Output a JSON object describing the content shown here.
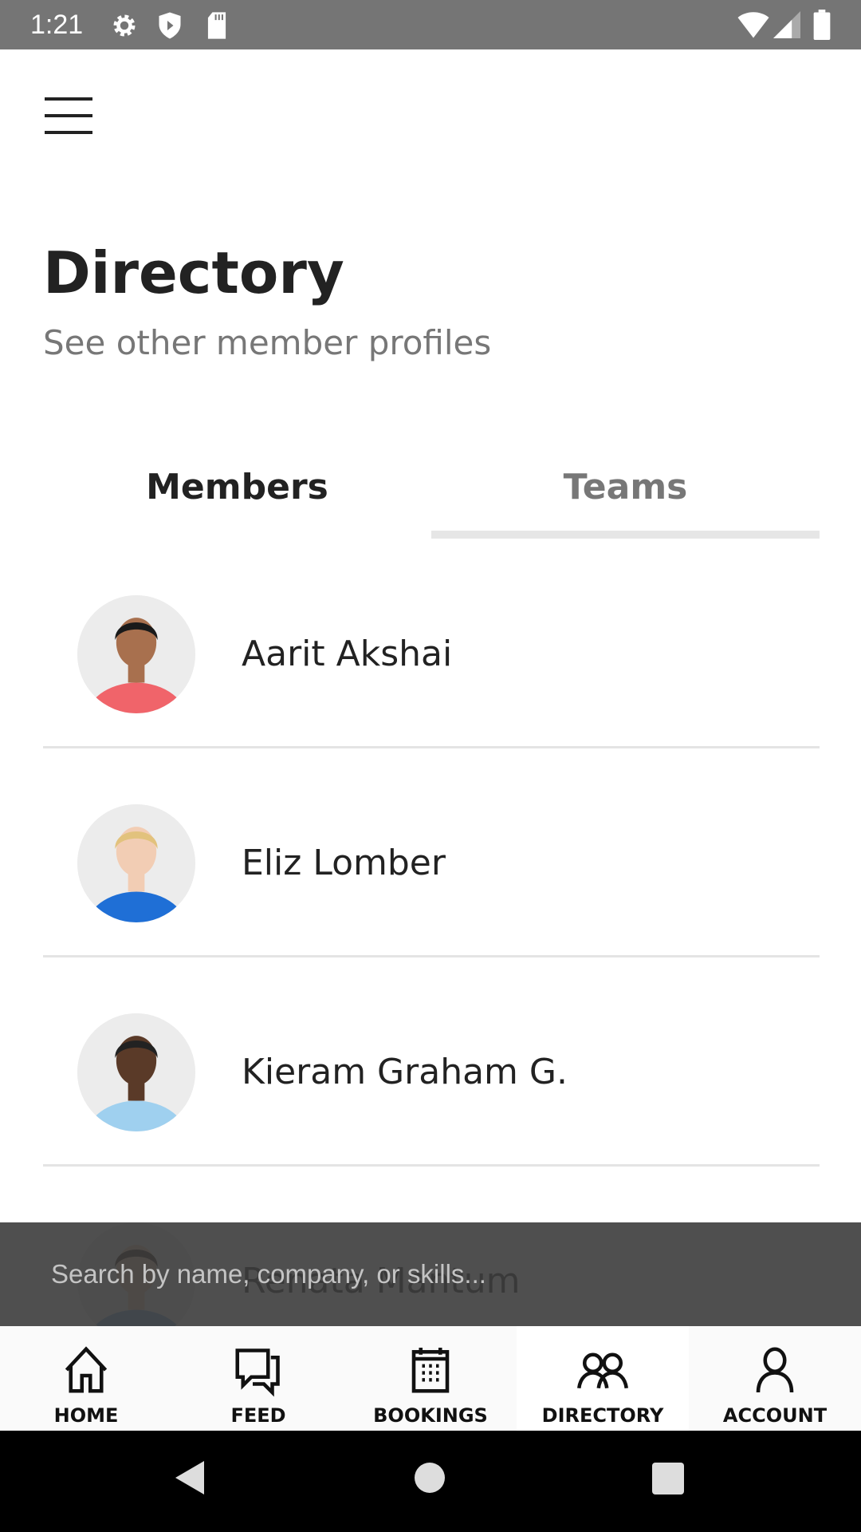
{
  "status_bar": {
    "time": "1:21",
    "icons": [
      "gear-icon",
      "shield-icon",
      "sd-card-icon",
      "wifi-icon",
      "signal-icon",
      "battery-icon"
    ]
  },
  "header": {
    "title": "Directory",
    "subtitle": "See other member profiles"
  },
  "tabs": [
    {
      "label": "Members",
      "active": true
    },
    {
      "label": "Teams",
      "active": false
    }
  ],
  "members": [
    {
      "name": "Aarit Akshai",
      "shirt": "#f0646a",
      "skin": "#a8704e",
      "hair": "#1a1a1a"
    },
    {
      "name": "Eliz Lomber",
      "shirt": "#1f6fd6",
      "skin": "#f2cdb4",
      "hair": "#e2c27d"
    },
    {
      "name": "Kieram Graham G.",
      "shirt": "#9fd0ef",
      "skin": "#5a3a28",
      "hair": "#222"
    },
    {
      "name": "Renata Mantum",
      "shirt": "#6fa7d6",
      "skin": "#e7c1a3",
      "hair": "#2a1a12"
    }
  ],
  "search": {
    "placeholder": "Search by name, company, or skills..."
  },
  "bottom_nav": [
    {
      "label": "HOME",
      "icon": "home-icon"
    },
    {
      "label": "FEED",
      "icon": "chat-icon"
    },
    {
      "label": "BOOKINGS",
      "icon": "calendar-icon"
    },
    {
      "label": "DIRECTORY",
      "icon": "people-icon",
      "active": true
    },
    {
      "label": "ACCOUNT",
      "icon": "person-icon"
    }
  ]
}
